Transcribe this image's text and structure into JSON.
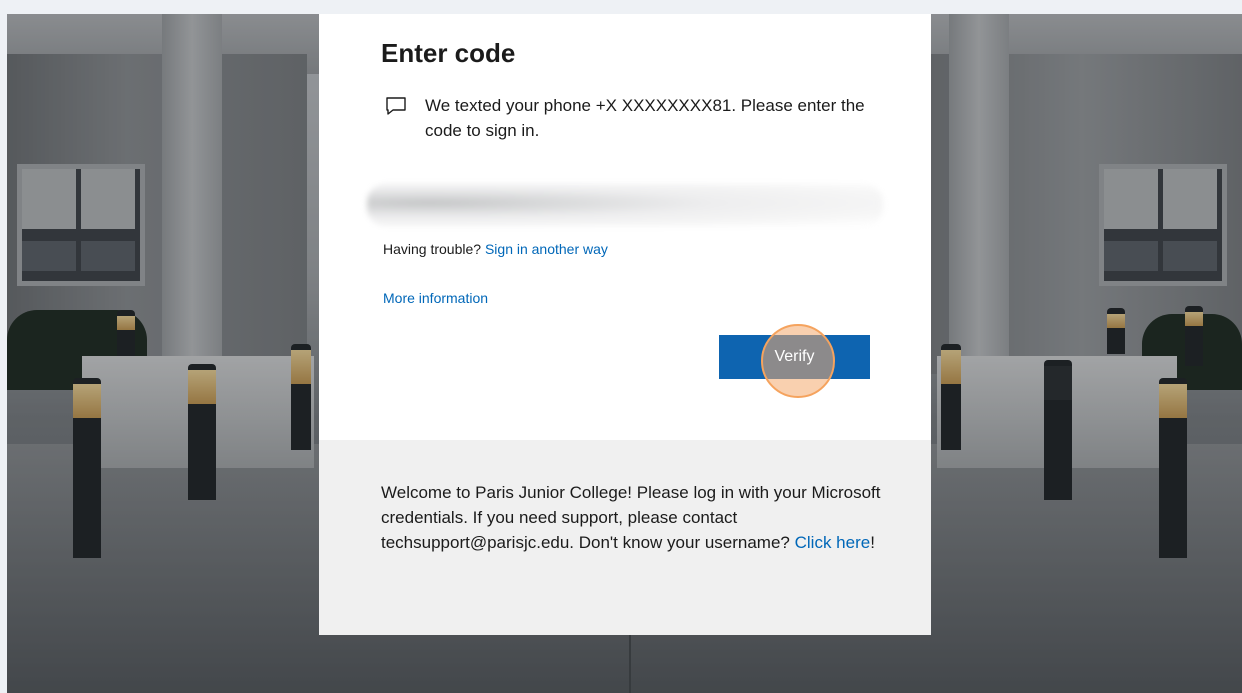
{
  "card": {
    "title": "Enter code",
    "message": "We texted your phone +X XXXXXXXX81. Please enter the code to sign in.",
    "trouble_prefix": "Having trouble? ",
    "trouble_link": "Sign in another way",
    "more_info_link": "More information",
    "verify_label": "Verify",
    "message_icon": "message-icon"
  },
  "footer": {
    "text_before": "Welcome to Paris Junior College! Please log in with your Microsoft credentials. If you need support, please contact techsupport@parisjc.edu. Don't know your username? ",
    "link": "Click here",
    "text_after": "!"
  },
  "colors": {
    "link": "#0067b8",
    "button": "#0e64b0",
    "highlight": "#f5a35e",
    "footer_bg": "#f0f0f0"
  }
}
